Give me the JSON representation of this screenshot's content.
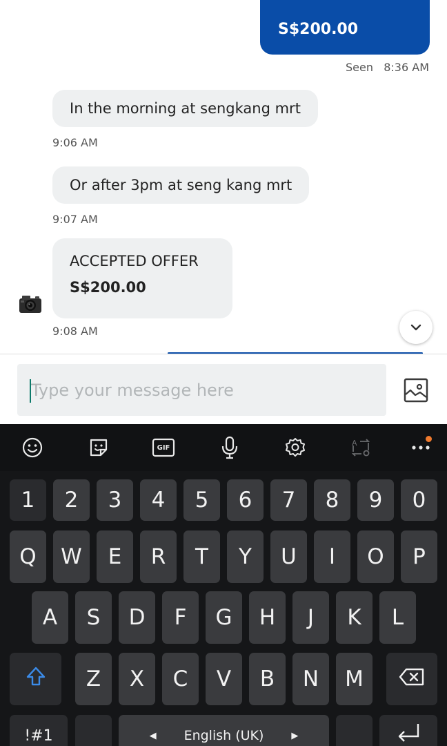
{
  "chat": {
    "sent_amount": "S$200.00",
    "seen_status": "Seen",
    "seen_time": "8:36 AM",
    "messages": [
      {
        "text": "In the morning at sengkang mrt",
        "time": "9:06 AM"
      },
      {
        "text": "Or after 3pm at seng kang mrt",
        "time": "9:07 AM"
      }
    ],
    "offer": {
      "title": "ACCEPTED OFFER",
      "price": "S$200.00",
      "time": "9:08 AM"
    },
    "avatar_icon": "camera-avatar",
    "scroll_icon": "chevron-down-icon"
  },
  "compose": {
    "placeholder": "Type your message here",
    "image_button_icon": "image-icon"
  },
  "keyboard": {
    "toolbar_icons": [
      "emoji-icon",
      "sticker-icon",
      "gif-icon",
      "microphone-icon",
      "settings-icon",
      "translate-icon",
      "more-icon"
    ],
    "gif_label": "GIF",
    "notification_color": "#f07a2e",
    "number_row": [
      "1",
      "2",
      "3",
      "4",
      "5",
      "6",
      "7",
      "8",
      "9",
      "0"
    ],
    "row1": [
      "Q",
      "W",
      "E",
      "R",
      "T",
      "Y",
      "U",
      "I",
      "O",
      "P"
    ],
    "row2": [
      "A",
      "S",
      "D",
      "F",
      "G",
      "H",
      "J",
      "K",
      "L"
    ],
    "row3": [
      "Z",
      "X",
      "C",
      "V",
      "B",
      "N",
      "M"
    ],
    "symbols_label": "!#1",
    "space_label": "English (UK)"
  },
  "colors": {
    "brand_blue": "#0a4da8",
    "bubble_gray": "#eef0f1",
    "keyboard_bg": "#151618",
    "key_bg": "#3a3b3e"
  }
}
